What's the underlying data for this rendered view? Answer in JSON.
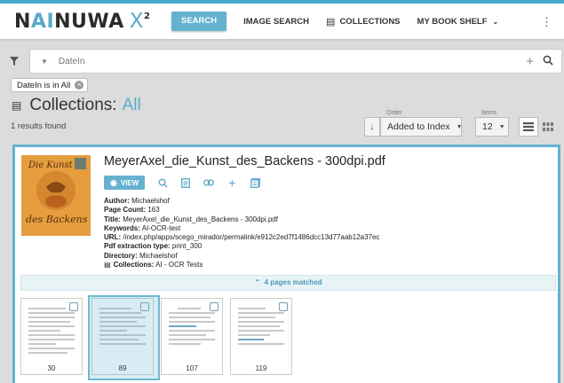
{
  "app": {
    "logo_text_a": "N",
    "logo_text_b": "AI",
    "logo_text_c": "NUWA",
    "logo_x": "X",
    "logo_sup": "2",
    "nav": {
      "search": "SEARCH",
      "image_search": "IMAGE SEARCH",
      "collections": "COLLECTIONS",
      "my_book_shelf": "MY BOOK SHELF"
    }
  },
  "filter": {
    "placeholder": "DateIn",
    "chip_label": "DateIn is in All"
  },
  "collections": {
    "heading": "Collections:",
    "current": "All"
  },
  "results": {
    "count_text": "1 results found"
  },
  "sort": {
    "order_label": "Order",
    "order_value": "Added to Index",
    "items_label": "Items",
    "items_value": "12"
  },
  "document": {
    "title": "MeyerAxel_die_Kunst_des_Backens - 300dpi.pdf",
    "view_label": "VIEW",
    "meta": {
      "author_label": "Author:",
      "author": "Michaelshof",
      "page_count_label": "Page Count:",
      "page_count": "163",
      "title_label": "Title:",
      "title": "MeyerAxel_die_Kunst_des_Backens - 300dpi.pdf",
      "keywords_label": "Keywords:",
      "keywords": "AI-OCR-test",
      "url_label": "URL:",
      "url": "/index.php/apps/scego_mirador/permalink/e912c2ed7f1486dcc13d77aab12a37ec",
      "pdf_type_label": "Pdf extraction type:",
      "pdf_type": "print_300",
      "directory_label": "Directory:",
      "directory": "Michaelshof",
      "collections_label": "Collections:",
      "collections": "AI - OCR Tests"
    },
    "matched_text": "4 pages matched",
    "pages": [
      "30",
      "89",
      "107",
      "119"
    ]
  },
  "colors": {
    "accent": "#64b2cf",
    "background": "#dcdcdc"
  }
}
